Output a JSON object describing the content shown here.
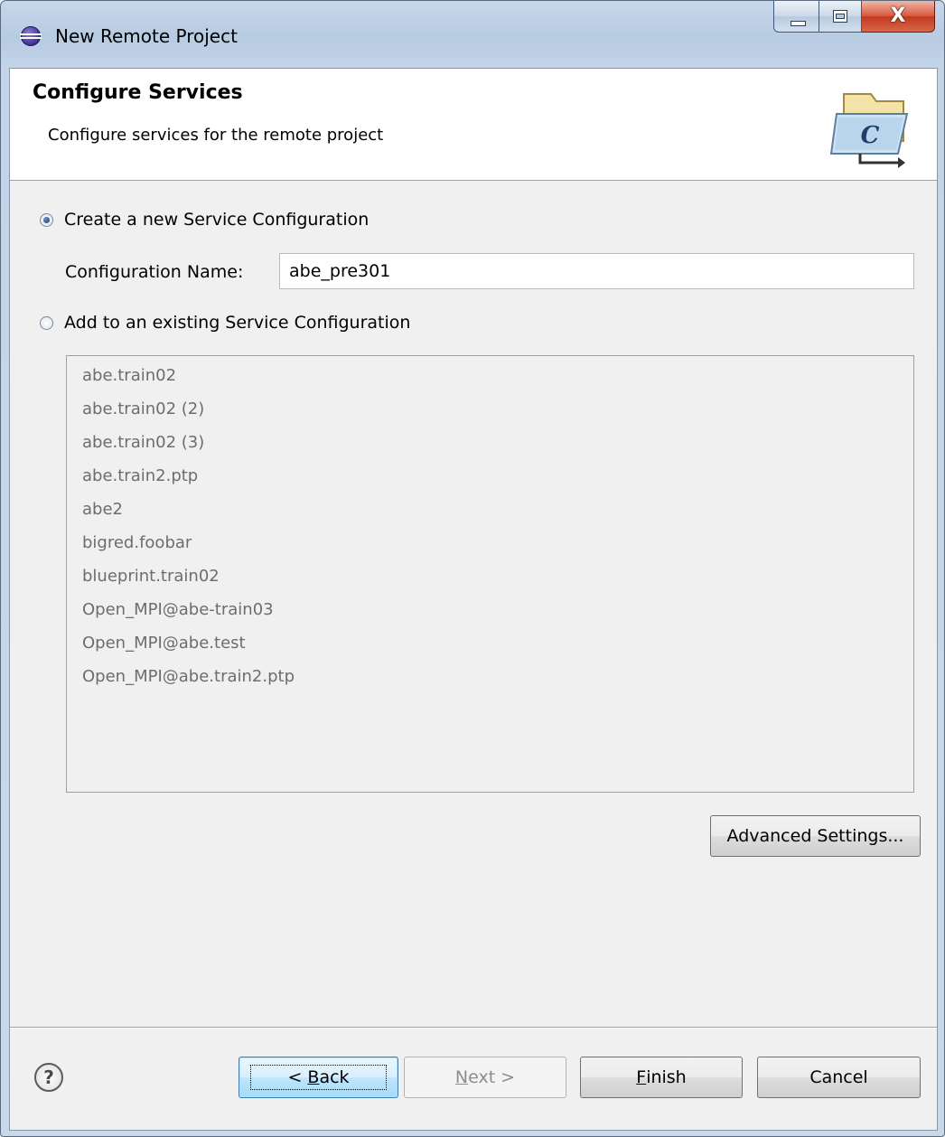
{
  "window": {
    "title": "New Remote Project",
    "icon": "eclipse-icon"
  },
  "banner": {
    "title": "Configure Services",
    "description": "Configure services for the remote project",
    "icon": "c-project-folder-icon"
  },
  "options": {
    "create_new_label": "Create a new Service Configuration",
    "create_new_selected": true,
    "config_name_label": "Configuration Name:",
    "config_name_value": "abe_pre301",
    "add_existing_label": "Add to an existing Service Configuration",
    "add_existing_selected": false
  },
  "existing_configs": [
    "abe.train02",
    "abe.train02 (2)",
    "abe.train02 (3)",
    "abe.train2.ptp",
    "abe2",
    "bigred.foobar",
    "blueprint.train02",
    "Open_MPI@abe-train03",
    "Open_MPI@abe.test",
    "Open_MPI@abe.train2.ptp"
  ],
  "buttons": {
    "advanced": "Advanced Settings...",
    "back_prefix": "< ",
    "back_mnemonic": "B",
    "back_rest": "ack",
    "next_mnemonic": "N",
    "next_rest": "ext >",
    "finish_mnemonic": "F",
    "finish_rest": "inish",
    "cancel": "Cancel",
    "help": "?"
  },
  "colors": {
    "title_bar": "#b7cbe2",
    "client_bg": "#f0f0f0",
    "close_button": "#c23a1f",
    "disabled_text": "#6d6d6d"
  }
}
